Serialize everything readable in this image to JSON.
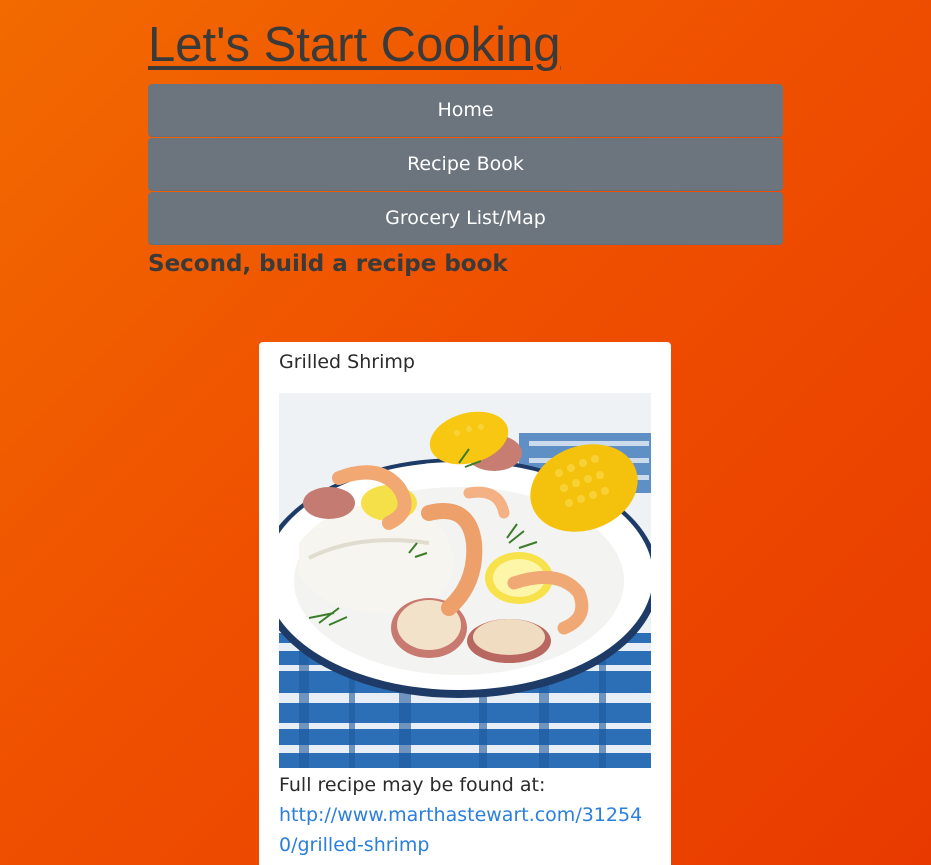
{
  "header": {
    "title": "Let's Start Cooking"
  },
  "nav": {
    "items": [
      {
        "label": "Home"
      },
      {
        "label": "Recipe Book"
      },
      {
        "label": "Grocery List/Map"
      }
    ]
  },
  "page": {
    "subtitle": "Second, build a recipe book"
  },
  "recipe_card": {
    "title": "Grilled Shrimp",
    "image_icon": "food-photo",
    "source_text": "Full recipe may be found at:",
    "source_link": "http://www.marthastewart.com/312540/grilled-shrimp"
  },
  "colors": {
    "background_start": "#f26a00",
    "background_end": "#e83a00",
    "nav_button": "#6c757d",
    "link": "#2a7fde",
    "text": "#3a3a3a"
  }
}
